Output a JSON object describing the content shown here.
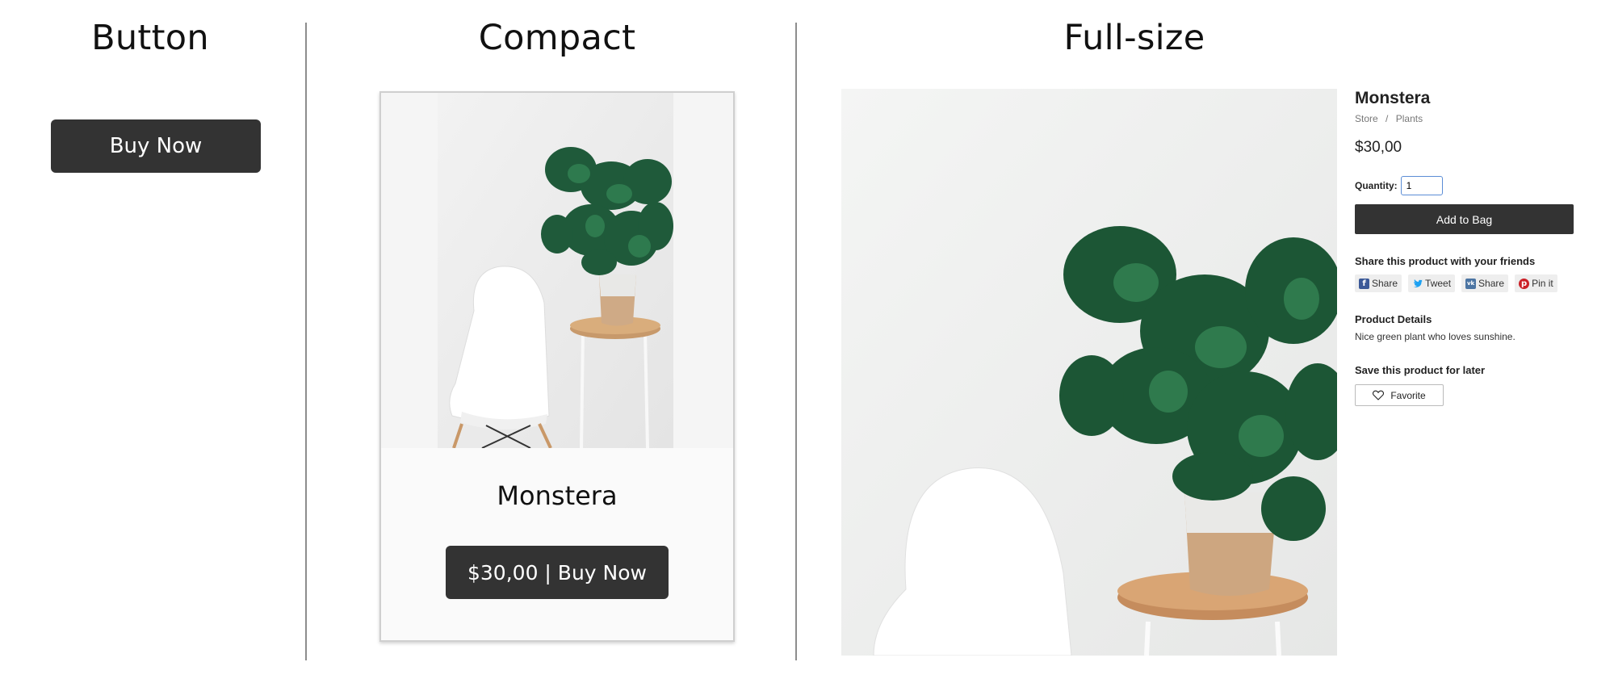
{
  "columns": {
    "button_title": "Button",
    "compact_title": "Compact",
    "full_title": "Full-size"
  },
  "button_col": {
    "buy_label": "Buy Now"
  },
  "compact": {
    "product_name": "Monstera",
    "buy_label": "$30,00 | Buy Now"
  },
  "full": {
    "product_name": "Monstera",
    "breadcrumb": [
      "Store",
      "/",
      "Plants"
    ],
    "price": "$30,00",
    "quantity_label": "Quantity:",
    "quantity_value": "1",
    "add_to_bag_label": "Add to Bag",
    "share_heading": "Share this product with your friends",
    "share_buttons": [
      {
        "label": "Share",
        "icon": "facebook-icon"
      },
      {
        "label": "Tweet",
        "icon": "twitter-icon"
      },
      {
        "label": "Share",
        "icon": "vk-icon"
      },
      {
        "label": "Pin it",
        "icon": "pinterest-icon"
      }
    ],
    "details_heading": "Product Details",
    "details_text": "Nice green plant who loves sunshine.",
    "save_heading": "Save this product for later",
    "favorite_label": "Favorite"
  },
  "colors": {
    "button_dark": "#333333",
    "leaf_green": "#1f5a3a",
    "facebook": "#3b5998",
    "twitter": "#1da1f2",
    "vk": "#4c75a3",
    "pinterest": "#cb2027"
  }
}
